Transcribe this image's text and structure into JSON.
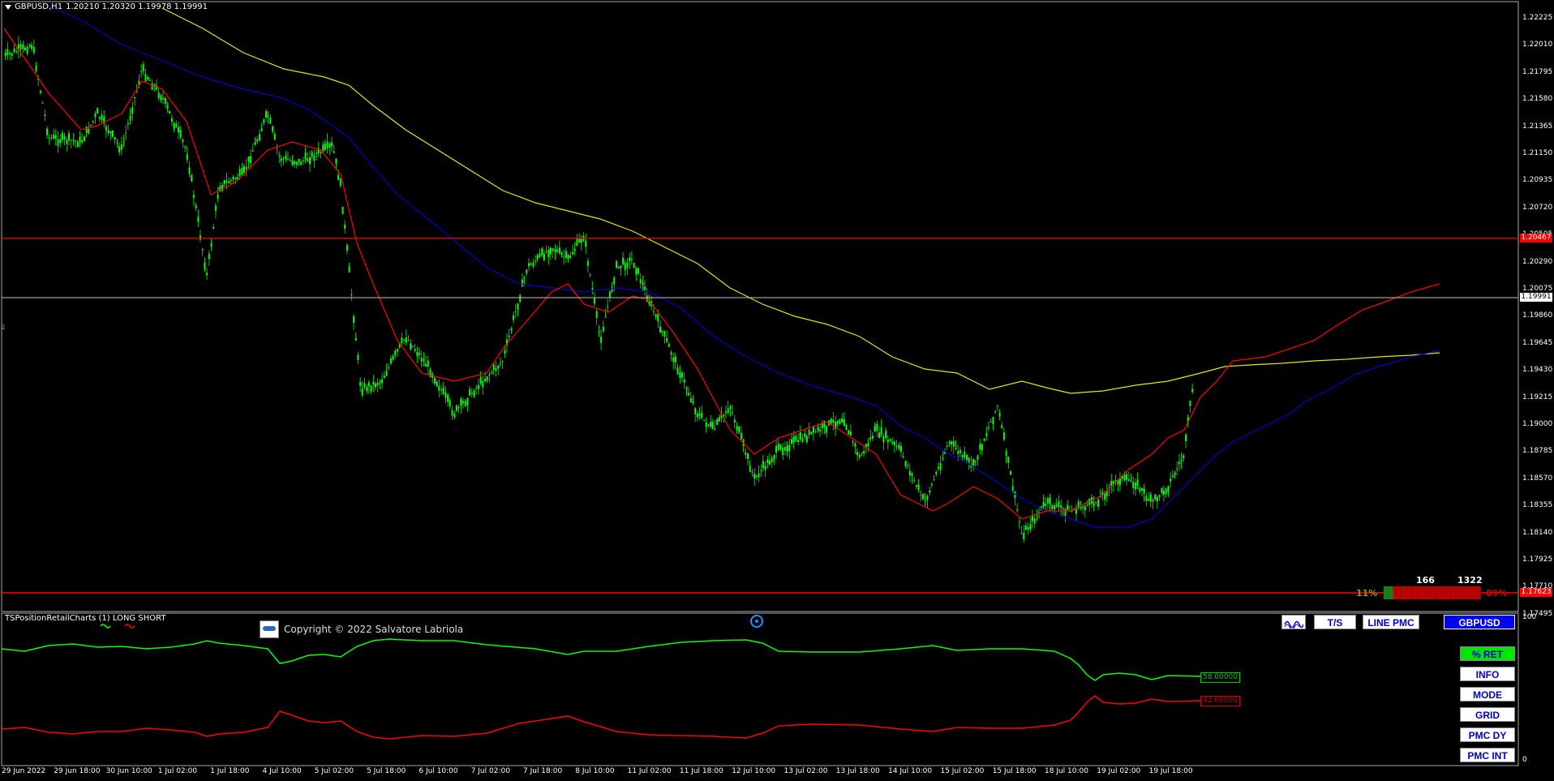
{
  "chart": {
    "symbol_tf": "GBPUSD,H1",
    "ohlc": "1.20210 1.20320 1.19978 1.19991",
    "colors": {
      "background": "#000000",
      "candle": "#00ff00",
      "ma_fast": "#ff0000",
      "ma_mid": "#0000cc",
      "ma_slow": "#e6e600",
      "level": "#ff0000",
      "bid": "#c0c0c0"
    }
  },
  "price_axis": [
    "1.22225",
    "1.22010",
    "1.21795",
    "1.21580",
    "1.21365",
    "1.21150",
    "1.20935",
    "1.20720",
    "1.20505",
    "1.20290",
    "1.20075",
    "1.19860",
    "1.19645",
    "1.19430",
    "1.19215",
    "1.19000",
    "1.18785",
    "1.18570",
    "1.18355",
    "1.18140",
    "1.17925",
    "1.17710",
    "1.17495"
  ],
  "price_tags": {
    "resistance": "1.20467",
    "bid": "1.19991",
    "support": "1.17623"
  },
  "time_axis": [
    "29 Jun 2022",
    "29 Jun 18:00",
    "30 Jun 10:00",
    "1 Jul 02:00",
    "1 Jul 18:00",
    "4 Jul 10:00",
    "5 Jul 02:00",
    "5 Jul 18:00",
    "6 Jul 10:00",
    "7 Jul 02:00",
    "7 Jul 18:00",
    "8 Jul 10:00",
    "11 Jul 02:00",
    "11 Jul 18:00",
    "12 Jul 10:00",
    "13 Jul 02:00",
    "13 Jul 18:00",
    "14 Jul 10:00",
    "15 Jul 02:00",
    "15 Jul 18:00",
    "18 Jul 10:00",
    "19 Jul 02:00",
    "19 Jul 18:00"
  ],
  "retail": {
    "long_count": "166",
    "short_count": "1322",
    "long_pct": "11%",
    "short_pct": "89%"
  },
  "indicator": {
    "name": "TSPositionRetailCharts (1) LONG SHORT",
    "copyright": "Copyright © 2022 Salvatore Labriola",
    "long_value": "58.00000",
    "short_value": "42.00000",
    "scale_top": "100",
    "scale_bottom": "0"
  },
  "toolbar": {
    "wave_icon": "wave-icon",
    "ts_label": "T/S",
    "line_pmc_label": "LINE PMC",
    "symbol_label": "GBPUSD"
  },
  "side_menu": [
    "% RET",
    "INFO",
    "MODE",
    "GRID",
    "PMC DY",
    "PMC INT"
  ]
}
